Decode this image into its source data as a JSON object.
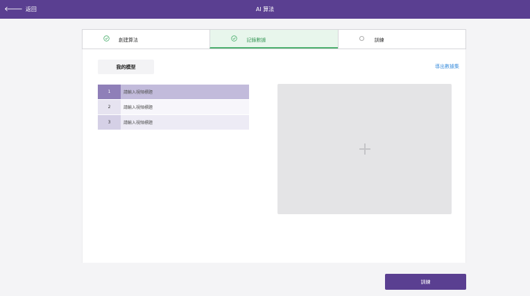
{
  "header": {
    "back_label": "返回",
    "title": "AI 算法"
  },
  "steps": [
    {
      "label": "創建算法",
      "state": "done"
    },
    {
      "label": "記錄數據",
      "state": "active"
    },
    {
      "label": "訓練",
      "state": "todo"
    }
  ],
  "panel": {
    "tab_label": "我的模型",
    "export_label": "導出數據集"
  },
  "videos": [
    {
      "index": "1",
      "placeholder": "請輸入視頻標題"
    },
    {
      "index": "2",
      "placeholder": "請輸入視頻標題"
    },
    {
      "index": "3",
      "placeholder": "請輸入視頻標題"
    }
  ],
  "footer": {
    "train_label": "訓練"
  },
  "colors": {
    "brand": "#5a3f91",
    "step_active": "#4caf6e",
    "link": "#3c8edc"
  }
}
